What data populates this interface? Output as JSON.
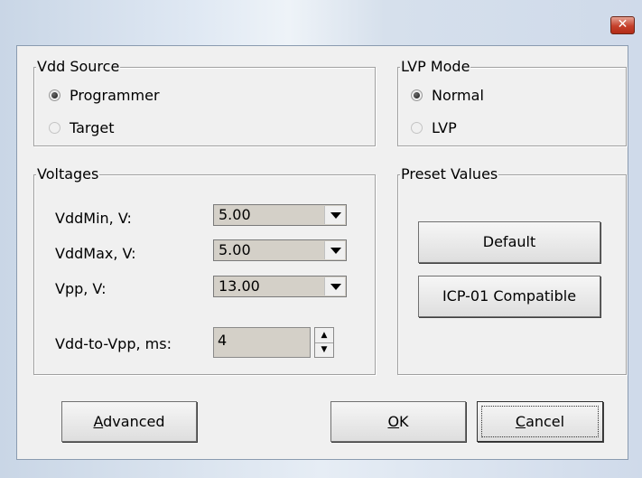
{
  "window": {
    "close_glyph": "✕"
  },
  "vdd_source": {
    "title": "Vdd Source",
    "options": [
      {
        "label": "Programmer",
        "checked": true
      },
      {
        "label": "Target",
        "checked": false
      }
    ]
  },
  "lvp_mode": {
    "title": "LVP Mode",
    "options": [
      {
        "label": "Normal",
        "checked": true
      },
      {
        "label": "LVP",
        "checked": false
      }
    ]
  },
  "voltages": {
    "title": "Voltages",
    "vddmin": {
      "label": "VddMin, V:",
      "value": "5.00"
    },
    "vddmax": {
      "label": "VddMax, V:",
      "value": "5.00"
    },
    "vpp": {
      "label": "Vpp, V:",
      "value": "13.00"
    },
    "vdd_to_vpp": {
      "label": "Vdd-to-Vpp, ms:",
      "value": "4"
    }
  },
  "preset": {
    "title": "Preset Values",
    "default_label": "Default",
    "icp_label": "ICP-01 Compatible"
  },
  "buttons": {
    "advanced_prefix": "A",
    "advanced_rest": "dvanced",
    "ok_prefix": "O",
    "ok_rest": "K",
    "cancel_prefix": "C",
    "cancel_rest": "ancel"
  }
}
